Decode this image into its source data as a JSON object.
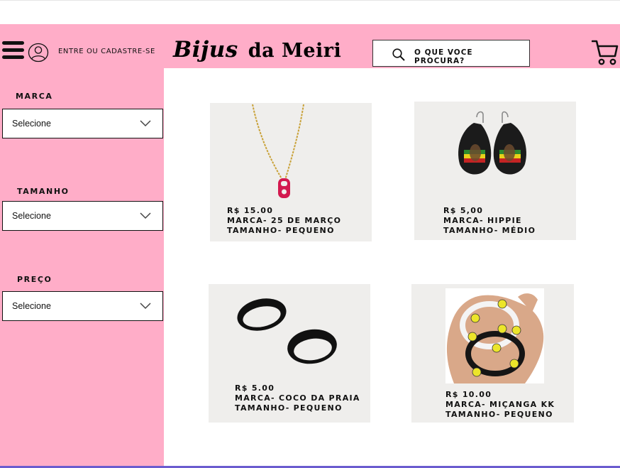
{
  "header": {
    "login_label": "ENTRE OU CADASTRE-SE",
    "logo_word1": "Bijus",
    "logo_word2": "da Meiri",
    "search_placeholder": "O QUE VOCE PROCURA?",
    "background_color": "#ffadc8"
  },
  "filters": [
    {
      "label": "MARCA",
      "selected": "Selecione"
    },
    {
      "label": "TAMANHO",
      "selected": "Selecione"
    },
    {
      "label": "PREÇO",
      "selected": "Selecione"
    }
  ],
  "products": [
    {
      "image": "necklace-with-red-can-tab",
      "price": "R$ 15.00",
      "brand": "MARCA- 25 DE MARÇO",
      "size": "TAMANHO- PEQUENO"
    },
    {
      "image": "bob-marley-earrings",
      "price": "R$ 5,00",
      "brand": "MARCA- HIPPIE",
      "size": "TAMANHO- MÉDIO"
    },
    {
      "image": "black-rings",
      "price": "R$ 5.00",
      "brand": "MARCA- COCO DA PRAIA",
      "size": "TAMANHO- PEQUENO"
    },
    {
      "image": "smiley-bead-bracelets",
      "price": "R$ 10.00",
      "brand": "MARCA- MIÇANGA KK",
      "size": "TAMANHO- PEQUENO"
    }
  ]
}
